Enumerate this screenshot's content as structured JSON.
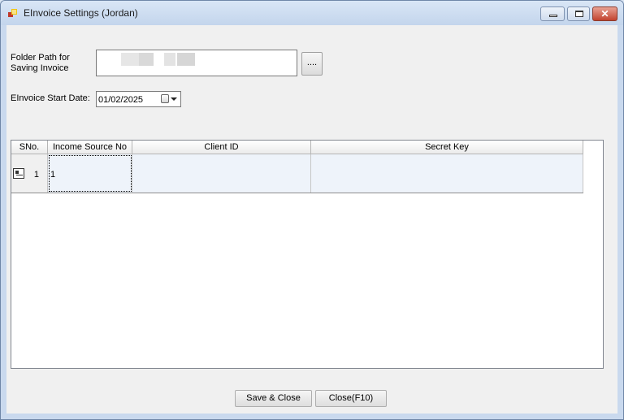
{
  "window": {
    "title": "EInvoice Settings (Jordan)",
    "close_glyph": "✕",
    "icons": {
      "app": "app-window-icon",
      "minimize": "minimize-icon",
      "maximize": "maximize-icon",
      "close": "close-icon"
    }
  },
  "form": {
    "folder_label": "Folder Path for Saving Invoice",
    "folder_value": "",
    "browse_label": "....",
    "start_date_label": "EInvoice Start Date:",
    "start_date_value": "01/02/2025",
    "date_icons": {
      "calendar": "calendar-icon",
      "dropdown": "chevron-down-icon"
    }
  },
  "grid": {
    "columns": [
      "SNo.",
      "Income Source No",
      "Client ID",
      "Secret Key"
    ],
    "rows": [
      {
        "sno": "1",
        "income_source_no": "1",
        "client_id": "",
        "secret_key": ""
      }
    ],
    "row_icon": "edit-row-icon"
  },
  "buttons": {
    "save_close": "Save & Close",
    "close": "Close(F10)"
  },
  "colors": {
    "title_bar": "#c3d5ec",
    "client_bg": "#f0f0f0",
    "row_bg": "#eef3fa",
    "close_button": "#c2432f"
  }
}
